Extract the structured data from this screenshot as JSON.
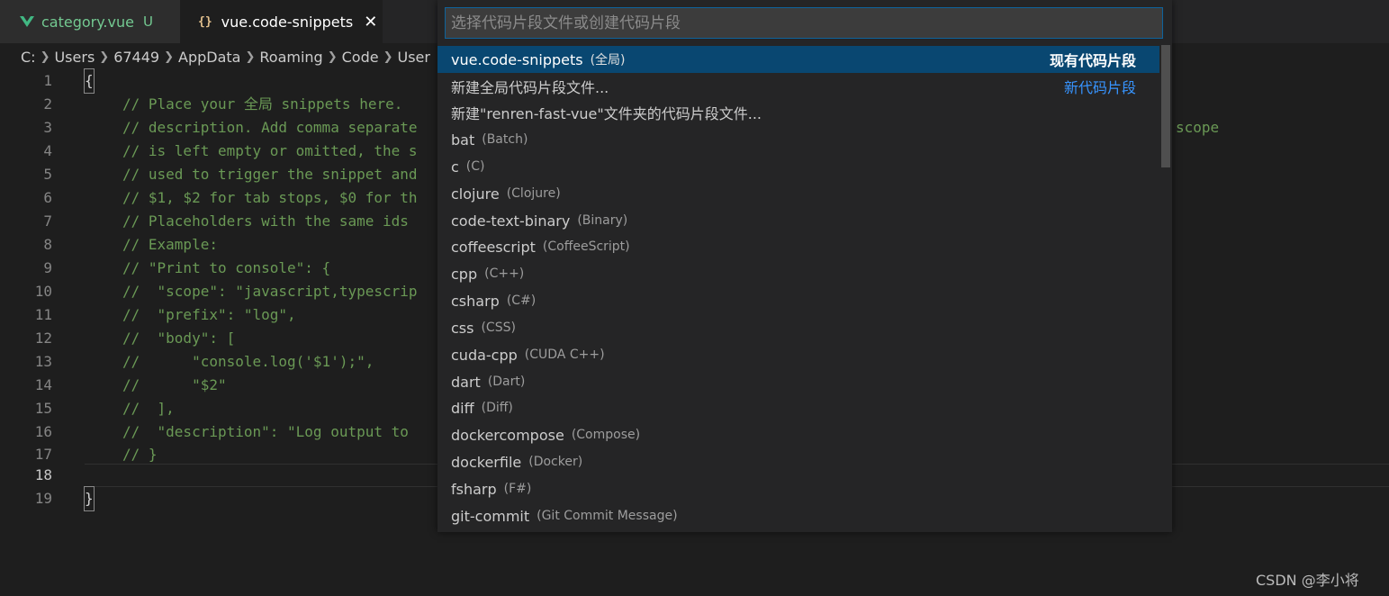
{
  "tabs": [
    {
      "label": "category.vue",
      "badge": "U",
      "icon": "vue-icon"
    },
    {
      "label": "vue.code-snippets",
      "icon": "braces-icon",
      "icon_glyph": "{}"
    }
  ],
  "breadcrumb": {
    "drive": "C:",
    "parts": [
      "Users",
      "67449",
      "AppData",
      "Roaming",
      "Code",
      "User"
    ]
  },
  "editor": {
    "lines": [
      {
        "n": "1",
        "text": "{"
      },
      {
        "n": "2",
        "text": "// Place your 全局 snippets here."
      },
      {
        "n": "3",
        "text": "// description. Add comma separate"
      },
      {
        "n": "4",
        "text": "// is left empty or omitted, the s"
      },
      {
        "n": "5",
        "text": "// used to trigger the snippet and"
      },
      {
        "n": "6",
        "text": "// $1, $2 for tab stops, $0 for th"
      },
      {
        "n": "7",
        "text": "// Placeholders with the same ids "
      },
      {
        "n": "8",
        "text": "// Example:"
      },
      {
        "n": "9",
        "text": "// \"Print to console\": {"
      },
      {
        "n": "10",
        "text": "//  \"scope\": \"javascript,typescrip"
      },
      {
        "n": "11",
        "text": "//  \"prefix\": \"log\","
      },
      {
        "n": "12",
        "text": "//  \"body\": ["
      },
      {
        "n": "13",
        "text": "//      \"console.log('$1');\","
      },
      {
        "n": "14",
        "text": "//      \"$2\""
      },
      {
        "n": "15",
        "text": "//  ],"
      },
      {
        "n": "16",
        "text": "//  \"description\": \"Log output to "
      },
      {
        "n": "17",
        "text": "// }"
      },
      {
        "n": "18",
        "text": ""
      },
      {
        "n": "19",
        "text": "}"
      }
    ],
    "line3_tail": "scope"
  },
  "quickpick": {
    "placeholder": "选择代码片段文件或创建代码片段",
    "items": [
      {
        "label": "vue.code-snippets",
        "desc": "(全局)",
        "right": "现有代码片段"
      },
      {
        "label": "新建全局代码片段文件...",
        "desc": "",
        "right": "新代码片段"
      },
      {
        "label": "新建\"renren-fast-vue\"文件夹的代码片段文件...",
        "desc": "",
        "right": ""
      },
      {
        "label": "bat",
        "desc": "(Batch)"
      },
      {
        "label": "c",
        "desc": "(C)"
      },
      {
        "label": "clojure",
        "desc": "(Clojure)"
      },
      {
        "label": "code-text-binary",
        "desc": "(Binary)"
      },
      {
        "label": "coffeescript",
        "desc": "(CoffeeScript)"
      },
      {
        "label": "cpp",
        "desc": "(C++)"
      },
      {
        "label": "csharp",
        "desc": "(C#)"
      },
      {
        "label": "css",
        "desc": "(CSS)"
      },
      {
        "label": "cuda-cpp",
        "desc": "(CUDA C++)"
      },
      {
        "label": "dart",
        "desc": "(Dart)"
      },
      {
        "label": "diff",
        "desc": "(Diff)"
      },
      {
        "label": "dockercompose",
        "desc": "(Compose)"
      },
      {
        "label": "dockerfile",
        "desc": "(Docker)"
      },
      {
        "label": "fsharp",
        "desc": "(F#)"
      },
      {
        "label": "git-commit",
        "desc": "(Git Commit Message)"
      }
    ]
  },
  "watermark": "CSDN @李小将",
  "colors": {
    "accent": "#0e639c",
    "selected": "#094771",
    "comment": "#6a9955",
    "link": "#3794ff"
  }
}
